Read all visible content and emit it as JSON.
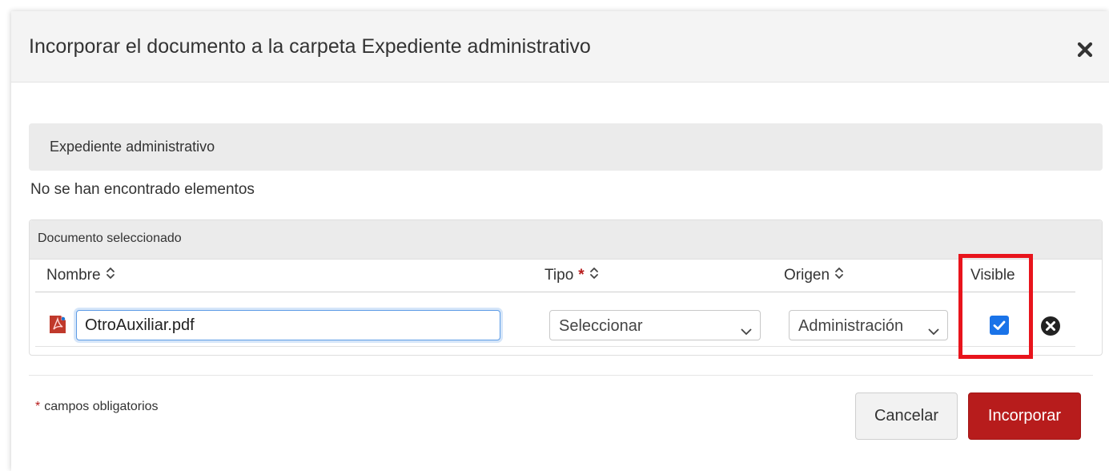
{
  "dialog": {
    "title": "Incorporar el documento a la carpeta Expediente administrativo",
    "close_icon": "close-x-icon"
  },
  "expediente_section": {
    "title": "Expediente administrativo",
    "empty_message": "No se han encontrado elementos"
  },
  "document_panel": {
    "title": "Documento seleccionado",
    "columns": [
      {
        "label": "Nombre",
        "sortable": true,
        "required": false
      },
      {
        "label": "Tipo",
        "sortable": true,
        "required": true
      },
      {
        "label": "Origen",
        "sortable": true,
        "required": false
      },
      {
        "label": "Visible",
        "sortable": false,
        "required": false
      }
    ],
    "required_marker": "*",
    "row": {
      "file_icon": "pdf-file-icon",
      "name_value": "OtroAuxiliar.pdf",
      "tipo_selected": "Seleccionar",
      "origen_selected": "Administración",
      "visible_checked": true,
      "remove_icon": "remove-circle-icon"
    }
  },
  "footer": {
    "required_marker": "*",
    "required_note": "campos obligatorios",
    "cancel_label": "Cancelar",
    "submit_label": "Incorporar"
  },
  "colors": {
    "primary_button": "#b71c1c",
    "required_star": "#b71c1c",
    "checkbox": "#1a73e8",
    "highlight": "#e8141c",
    "focus_border": "#5d9ce6"
  }
}
